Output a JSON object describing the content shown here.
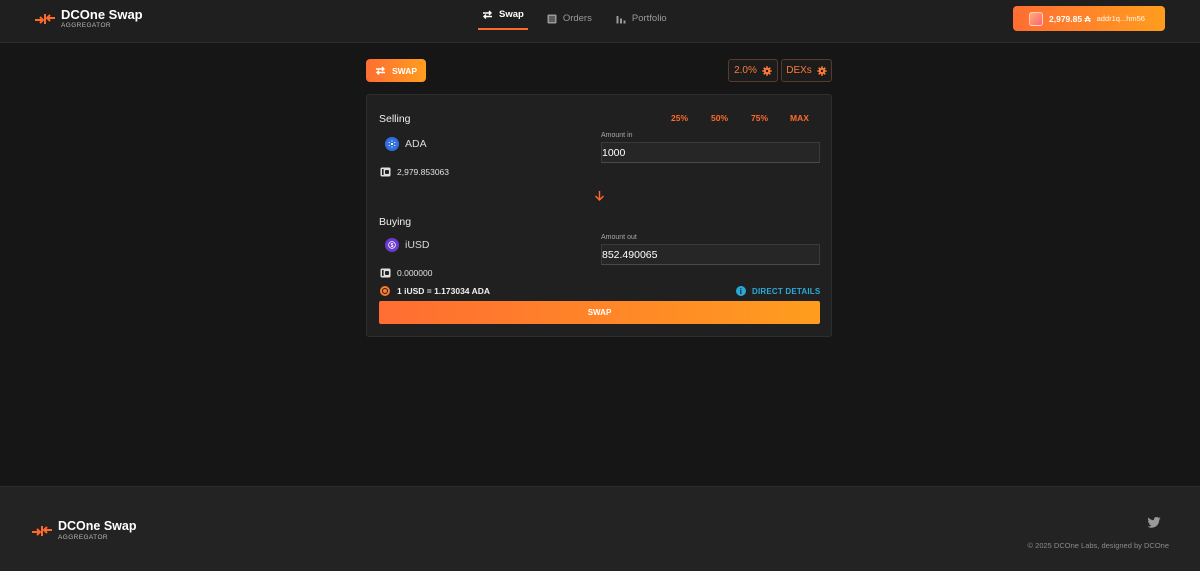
{
  "header": {
    "brand": {
      "title": "DCOne Swap",
      "subtitle": "AGGREGATOR"
    },
    "nav": [
      {
        "label": "Swap",
        "icon": "swap-icon",
        "active": true
      },
      {
        "label": "Orders",
        "icon": "orders-icon",
        "active": false
      },
      {
        "label": "Portfolio",
        "icon": "portfolio-icon",
        "active": false
      }
    ],
    "wallet": {
      "balance": "2,979.85 ₳",
      "address": "addr1q...hm56"
    }
  },
  "controls": {
    "swap_tab": "SWAP",
    "slippage": "2.0%",
    "dexs": "DEXs"
  },
  "swap": {
    "selling": {
      "label": "Selling",
      "percent_buttons": [
        "25%",
        "50%",
        "75%",
        "MAX"
      ],
      "token": "ADA",
      "balance": "2,979.853063",
      "field_label": "Amount in",
      "amount": "1000"
    },
    "buying": {
      "label": "Buying",
      "token": "iUSD",
      "balance": "0.000000",
      "field_label": "Amount out",
      "amount": "852.490065"
    },
    "rate": "1 iUSD = 1.173034 ADA",
    "details": "DIRECT DETAILS",
    "submit": "SWAP"
  },
  "footer": {
    "brand": {
      "title": "DCOne Swap",
      "subtitle": "AGGREGATOR"
    },
    "copyright": "© 2025 DCOne Labs, designed by DCOne"
  },
  "colors": {
    "accent": "#ff6a2b",
    "accent_gradient_end": "#ff9d1e",
    "link": "#2aa9d8",
    "background": "#161616",
    "card": "#202020"
  }
}
